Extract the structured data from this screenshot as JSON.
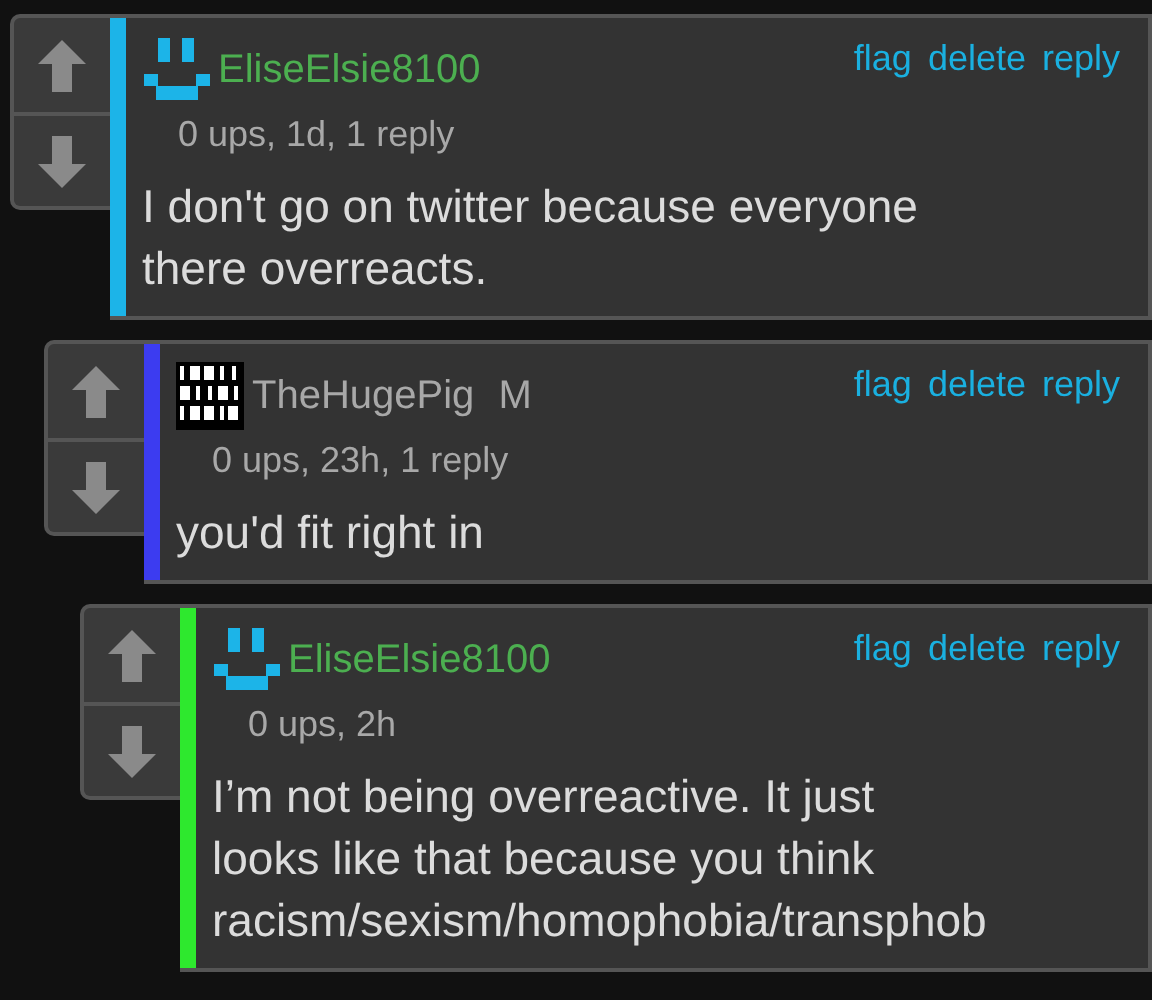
{
  "comments": [
    {
      "avatar": {
        "kind": "smiley"
      },
      "user": {
        "name": "EliseElsie8100",
        "color": "#4caf50"
      },
      "color": "#1cb4e8",
      "meta": "0 ups, 1d, 1 reply",
      "actions": [
        "flag",
        "delete",
        "reply"
      ],
      "body_lines": [
        "I don't go on twitter because everyone",
        "there overreacts."
      ],
      "children": [
        {
          "avatar": {
            "kind": "binary"
          },
          "user": {
            "name": "TheHugePig",
            "color": "#a8a8a8"
          },
          "badge": "M",
          "color": "#3c3cf0",
          "meta": "0 ups, 23h, 1 reply",
          "actions": [
            "flag",
            "delete",
            "reply"
          ],
          "body_lines": [
            "you'd fit right in"
          ],
          "children": [
            {
              "avatar": {
                "kind": "smiley"
              },
              "user": {
                "name": "EliseElsie8100",
                "color": "#4caf50"
              },
              "color": "#2ee82e",
              "meta": "0 ups, 2h",
              "actions": [
                "flag",
                "delete",
                "reply"
              ],
              "body_lines": [
                "I’m not being overreactive. It just",
                "looks like that because you think",
                "racism/sexism/homophobia/transphob"
              ]
            }
          ]
        }
      ]
    }
  ]
}
